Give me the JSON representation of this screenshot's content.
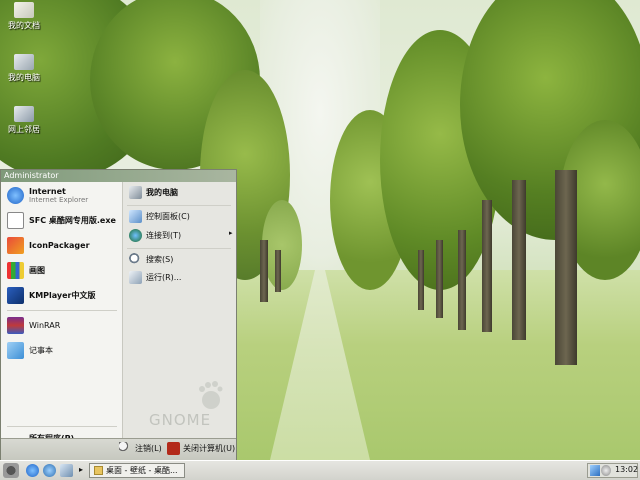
{
  "desktop": {
    "icons": [
      {
        "label": "我的文档"
      },
      {
        "label": "我的电脑"
      },
      {
        "label": "网上邻居"
      }
    ]
  },
  "start_menu": {
    "user": "Administrator",
    "left_items": [
      {
        "label": "Internet",
        "sublabel": "Internet Explorer"
      },
      {
        "label": "SFC 桌酷网专用版.exe"
      },
      {
        "label": "IconPackager"
      },
      {
        "label": "画图"
      },
      {
        "label": "KMPlayer中文版"
      },
      {
        "label": "WinRAR"
      },
      {
        "label": "记事本"
      }
    ],
    "all_programs": "所有程序(P)",
    "right_items": [
      {
        "label": "我的电脑"
      },
      {
        "label": "控制面板(C)"
      },
      {
        "label": "连接到(T)"
      },
      {
        "label": "搜索(S)"
      },
      {
        "label": "运行(R)..."
      }
    ],
    "brand": "GNOME",
    "logoff": "注销(L)",
    "shutdown": "关闭计算机(U)"
  },
  "taskbar": {
    "task_label": "桌面 - 壁纸 - 桌酷...",
    "clock": "13:02"
  },
  "colors": {
    "accent_header": "#7f9a7a",
    "menu_bg": "#e9e9e6"
  }
}
